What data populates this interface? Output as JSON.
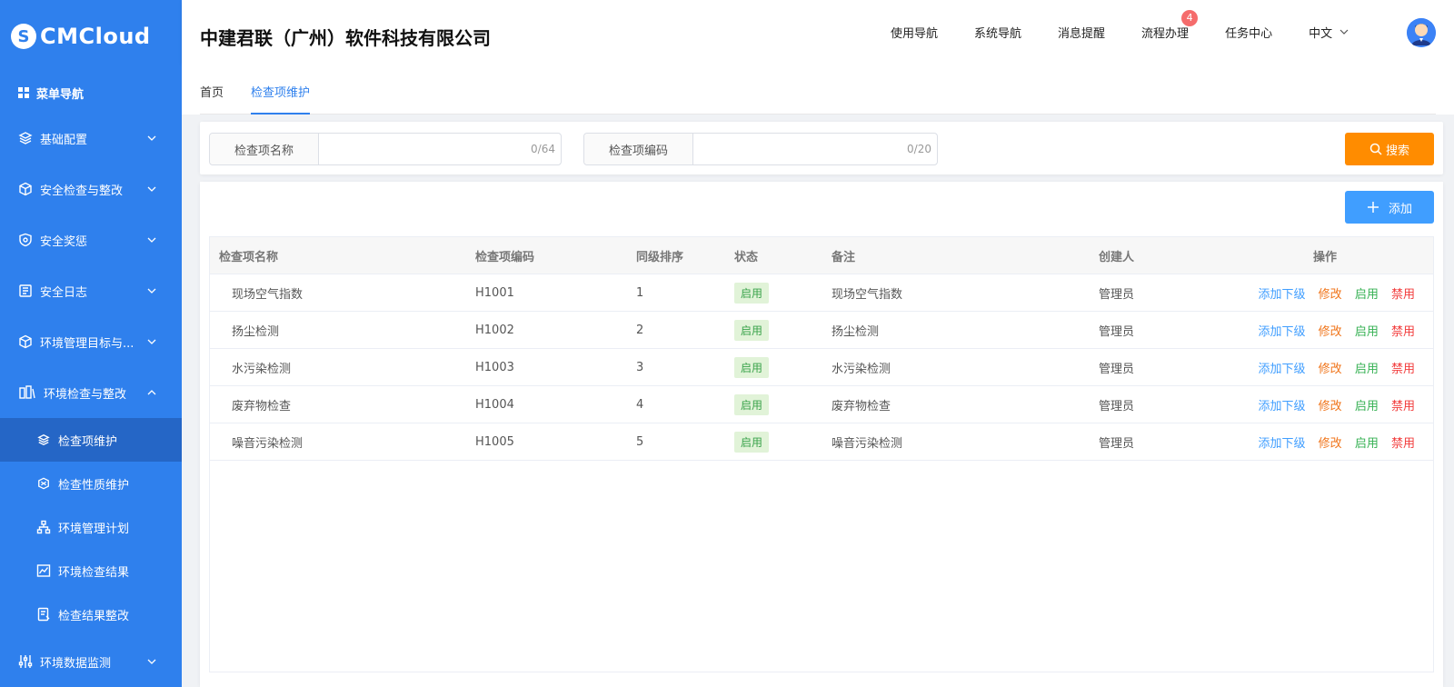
{
  "sidebar": {
    "logo_text": "CMCloud",
    "menu_head": "菜单导航",
    "items": [
      {
        "label": "基础配置",
        "icon": "layers-icon",
        "expanded": false
      },
      {
        "label": "安全检查与整改",
        "icon": "cube-icon",
        "expanded": false
      },
      {
        "label": "安全奖惩",
        "icon": "shield-icon",
        "expanded": false
      },
      {
        "label": "安全日志",
        "icon": "log-icon",
        "expanded": false
      },
      {
        "label": "环境管理目标与...",
        "icon": "box-icon",
        "expanded": false
      },
      {
        "label": "环境检查与整改",
        "icon": "inspect-icon",
        "expanded": true
      },
      {
        "label": "环境数据监测",
        "icon": "sliders-icon",
        "expanded": false
      }
    ],
    "subitems": [
      {
        "label": "检查项维护",
        "icon": "layers-icon",
        "active": true
      },
      {
        "label": "检查性质维护",
        "icon": "hexagon-icon",
        "active": false
      },
      {
        "label": "环境管理计划",
        "icon": "org-chart-icon",
        "active": false
      },
      {
        "label": "环境检查结果",
        "icon": "line-chart-icon",
        "active": false
      },
      {
        "label": "检查结果整改",
        "icon": "document-edit-icon",
        "active": false
      }
    ]
  },
  "header": {
    "company": "中建君联（广州）软件科技有限公司",
    "nav": [
      "使用导航",
      "系统导航",
      "消息提醒",
      "流程办理",
      "任务中心"
    ],
    "badge_count": "4",
    "language": "中文"
  },
  "tabs": [
    {
      "label": "首页",
      "active": false
    },
    {
      "label": "检查项维护",
      "active": true
    }
  ],
  "search": {
    "name_label": "检查项名称",
    "name_value": "",
    "name_counter": "0/64",
    "code_label": "检查项编码",
    "code_value": "",
    "code_counter": "0/20",
    "search_button": "搜索"
  },
  "toolbar": {
    "add_button": "添加"
  },
  "table": {
    "columns": [
      "检查项名称",
      "检查项编码",
      "同级排序",
      "状态",
      "备注",
      "创建人",
      "操作"
    ],
    "rows": [
      {
        "name": "现场空气指数",
        "code": "H1001",
        "order": "1",
        "status": "启用",
        "remark": "现场空气指数",
        "creator": "管理员"
      },
      {
        "name": "扬尘检测",
        "code": "H1002",
        "order": "2",
        "status": "启用",
        "remark": "扬尘检测",
        "creator": "管理员"
      },
      {
        "name": "水污染检测",
        "code": "H1003",
        "order": "3",
        "status": "启用",
        "remark": "水污染检测",
        "creator": "管理员"
      },
      {
        "name": "废弃物检查",
        "code": "H1004",
        "order": "4",
        "status": "启用",
        "remark": "废弃物检查",
        "creator": "管理员"
      },
      {
        "name": "噪音污染检测",
        "code": "H1005",
        "order": "5",
        "status": "启用",
        "remark": "噪音污染检测",
        "creator": "管理员"
      }
    ],
    "actions": {
      "add_child": "添加下级",
      "edit": "修改",
      "enable": "启用",
      "disable": "禁用"
    }
  },
  "colors": {
    "sidebar_bg": "#2f80ed",
    "sidebar_active": "#2566c6",
    "primary": "#409eff",
    "search_button": "#ff8c00",
    "status_green": "#3aa34b",
    "edit_orange": "#f0751b",
    "disable_red": "#f23c3c",
    "badge_red": "#f56c6c"
  }
}
